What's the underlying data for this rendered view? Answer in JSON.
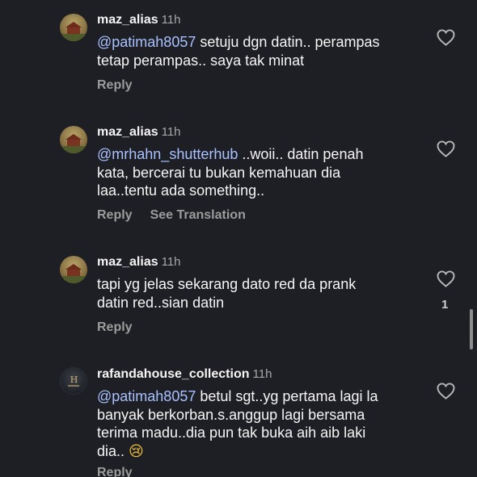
{
  "comments": [
    {
      "username": "maz_alias",
      "time": "11h",
      "mention": "@patimah8057",
      "body": " setuju dgn datin.. perampas\ntetap perampas.. saya tak minat",
      "reply_label": "Reply",
      "translation_label": "",
      "likes": ""
    },
    {
      "username": "maz_alias",
      "time": "11h",
      "mention": "@mrhahn_shutterhub",
      "body": " ..woii.. datin penah\nkata, bercerai tu bukan kemahuan dia\nlaa..tentu ada something..",
      "reply_label": "Reply",
      "translation_label": "See Translation",
      "likes": ""
    },
    {
      "username": "maz_alias",
      "time": "11h",
      "mention": "",
      "body": "tapi yg jelas sekarang dato red da prank\ndatin red..sian datin",
      "reply_label": "Reply",
      "translation_label": "",
      "likes": "1"
    },
    {
      "username": "rafandahouse_collection",
      "time": "11h",
      "mention": "@patimah8057",
      "body": " betul sgt..yg pertama lagi la\nbanyak berkorban.s.anggup lagi bersama\nterima madu..dia pun tak buka aih aib laki\ndia.. ",
      "emoji": "😢",
      "reply_label": "Reply",
      "translation_label": "",
      "likes": ""
    }
  ],
  "avatars": {
    "maz_alias": "house-photo-avatar",
    "rafandahouse_collection": "logo-monogram-avatar",
    "logo_monogram": "H"
  },
  "icons": {
    "like": "heart-outline-icon"
  },
  "colors": {
    "background": "#1e1f24",
    "mention": "#a9c1ff",
    "secondary_text": "#9c9c9c"
  }
}
